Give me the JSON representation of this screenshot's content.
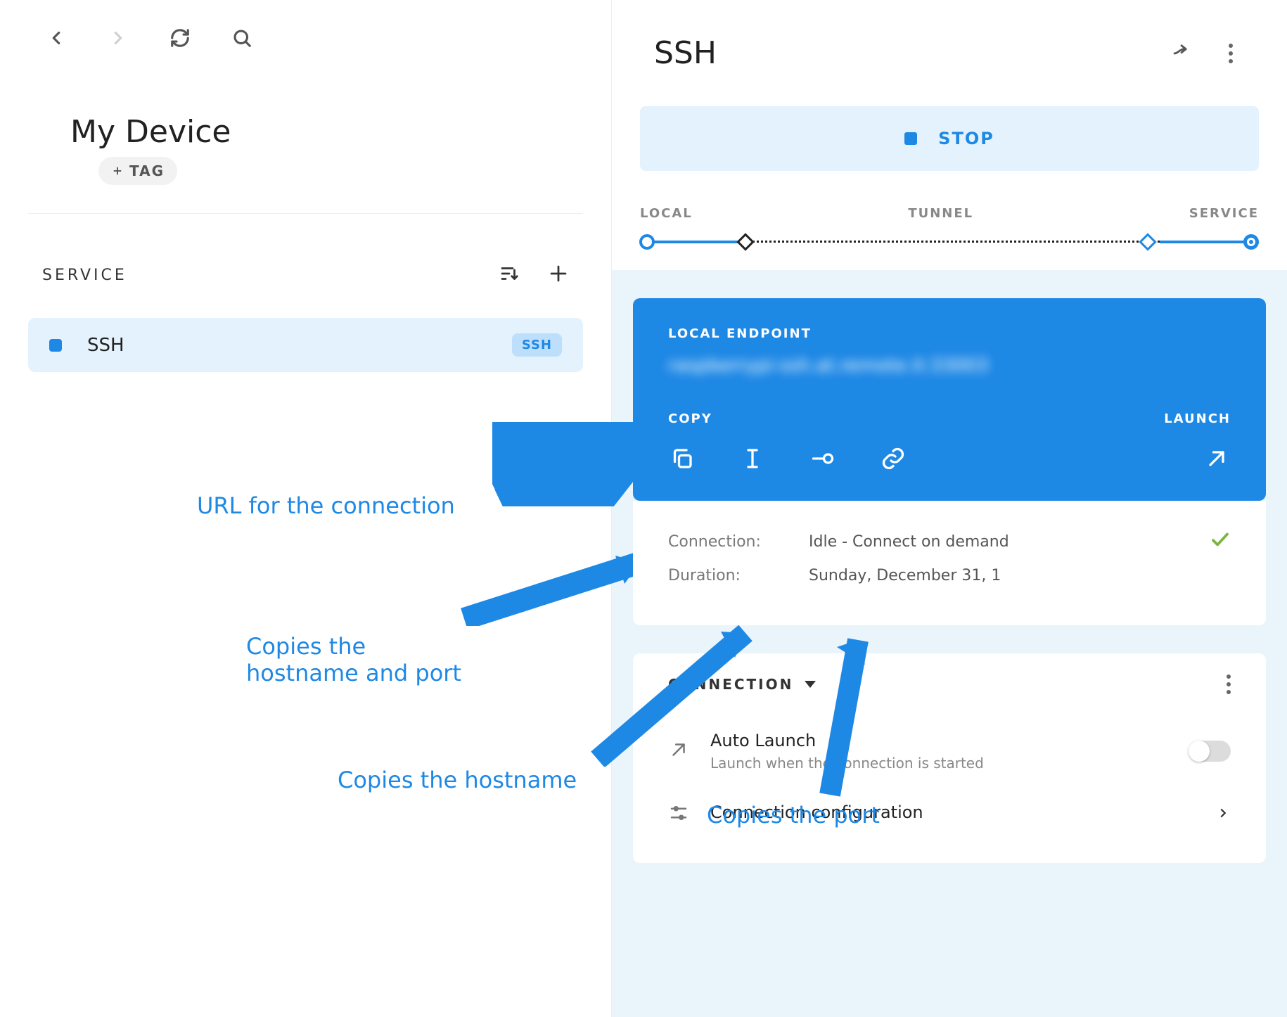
{
  "device": {
    "name": "My Device",
    "tag_label": "TAG"
  },
  "service_section": {
    "heading": "SERVICE"
  },
  "services": [
    {
      "name": "SSH",
      "badge": "SSH"
    }
  ],
  "right": {
    "title": "SSH",
    "stop_label": "STOP",
    "status_labels": {
      "local": "LOCAL",
      "tunnel": "TUNNEL",
      "service": "SERVICE"
    },
    "endpoint_card": {
      "label": "LOCAL ENDPOINT",
      "endpoint_value": "raspberrypi-ssh.at.remote.it:33003",
      "copy_label": "COPY",
      "launch_label": "LAUNCH"
    },
    "info": {
      "connection_label": "Connection:",
      "connection_value": "Idle - Connect on demand",
      "duration_label": "Duration:",
      "duration_value": "Sunday, December 31, 1"
    },
    "connection_section": {
      "heading": "CONNECTION",
      "auto_launch_title": "Auto Launch",
      "auto_launch_sub": "Launch when the connection is started",
      "conn_config_title": "Connection configuration"
    }
  },
  "annotations": {
    "a1": "URL for the connection",
    "a2": "Copies the\nhostname and port",
    "a3": "Copies the hostname",
    "a4": "Copies the port"
  }
}
